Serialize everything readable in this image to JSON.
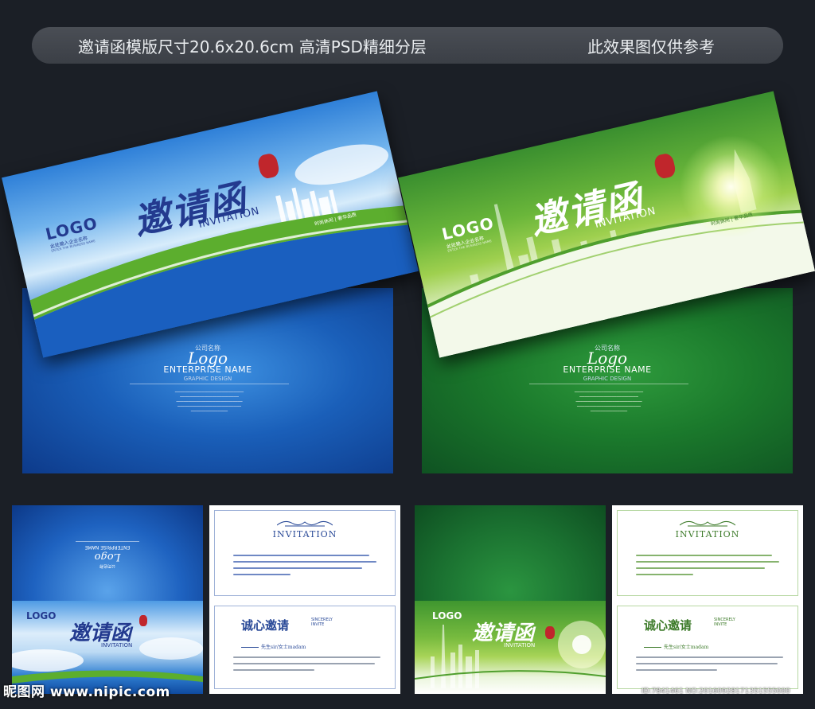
{
  "banner": {
    "left_text": "邀请函模版尺寸20.6x20.6cm  高清PSD精细分层",
    "right_text": "此效果图仅供参考"
  },
  "card": {
    "logo": "LOGO",
    "logo_cn": "此处输入企业名称",
    "logo_en": "ENTER THE BUSINESS NAME",
    "title": "邀请函",
    "invitation": "INVITATION",
    "tagline": "时尚休闲 | 奢华品质"
  },
  "back": {
    "company_cn": "公司名称",
    "logo": "Logo",
    "enterprise": "ENTERPRISE NAME",
    "graphic": "GRAPHIC DESIGN"
  },
  "inner": {
    "invitation_head": "INVITATION",
    "sincere": "诚心邀请",
    "sincere_en_1": "SINCERELY",
    "sincere_en_2": "INVITE",
    "salute": "先生sir/女士madam"
  },
  "footer": {
    "watermark": "昵图网 www.nipic.com",
    "id_line": "ID:7841461 NO:20160928171351555000"
  },
  "colors": {
    "blue_ink": "#2a4a98",
    "green_ink": "#3d7b2a",
    "seal_red": "#c0262c"
  }
}
